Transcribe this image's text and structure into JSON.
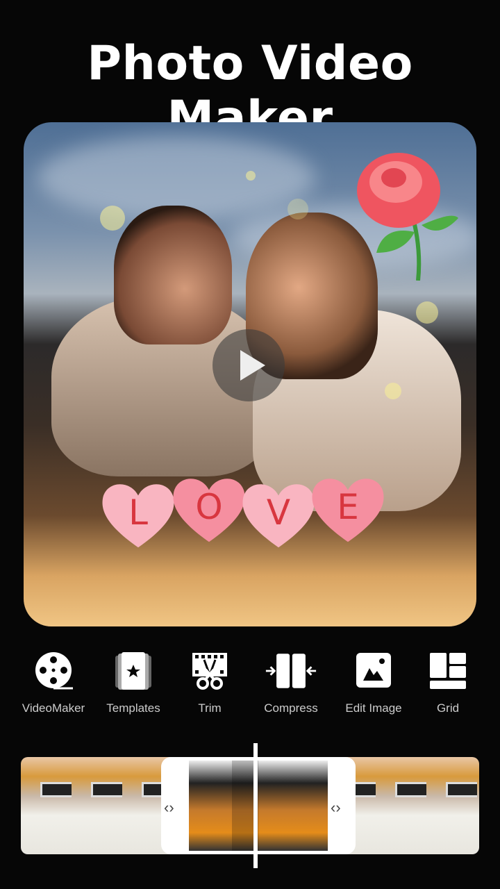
{
  "header": {
    "title": "Photo Video Maker"
  },
  "preview": {
    "sticker_letters": [
      "L",
      "O",
      "V",
      "E"
    ],
    "play_icon": "play-icon"
  },
  "tools": [
    {
      "label": "VideoMaker",
      "icon": "film-reel-icon"
    },
    {
      "label": "Templates",
      "icon": "templates-star-icon"
    },
    {
      "label": "Trim",
      "icon": "film-scissors-icon"
    },
    {
      "label": "Compress",
      "icon": "compress-arrows-icon"
    },
    {
      "label": "Edit Image",
      "icon": "image-icon"
    },
    {
      "label": "Grid",
      "icon": "grid-layout-icon"
    }
  ],
  "colors": {
    "background": "#060606",
    "text": "#ffffff",
    "label": "#cccccc"
  }
}
